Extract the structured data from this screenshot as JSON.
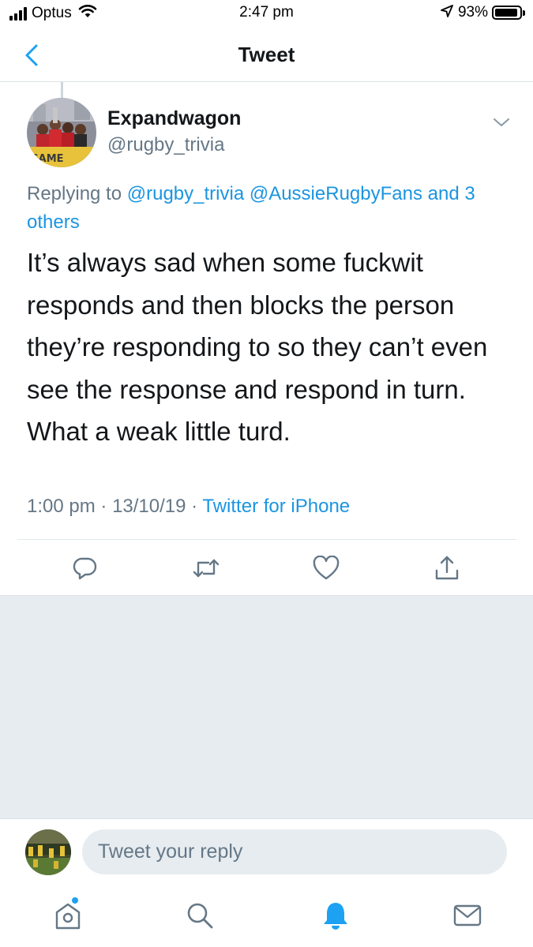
{
  "status_bar": {
    "carrier": "Optus",
    "time": "2:47 pm",
    "battery_percent": "93%",
    "battery_level": 0.93,
    "icons": [
      "signal-icon",
      "wifi-icon",
      "location-arrow-icon",
      "battery-icon"
    ]
  },
  "nav": {
    "title": "Tweet",
    "back_icon": "chevron-left-icon"
  },
  "tweet": {
    "author_name": "Expandwagon",
    "author_handle": "@rugby_trivia",
    "avatar_text": "GAME",
    "replying_prefix": "Replying to",
    "replying_to": "@rugby_trivia @AussieRugbyFans and 3 others",
    "text": "It’s always sad when some fuckwit responds and then blocks the person they’re responding to so they can’t even see the response and respond in turn. What a weak little turd.",
    "time": "1:00 pm",
    "date": "13/10/19",
    "separator": "·",
    "source": "Twitter for iPhone",
    "actions": [
      "reply-icon",
      "retweet-icon",
      "like-icon",
      "share-icon"
    ]
  },
  "reply_box": {
    "placeholder": "Tweet your reply"
  },
  "tab_bar": {
    "items": [
      "home-icon",
      "search-icon",
      "notifications-icon",
      "messages-icon"
    ],
    "active": "notifications-icon",
    "home_has_dot": true
  },
  "colors": {
    "accent": "#1da1f2",
    "link": "#1b95e0",
    "secondary_text": "#657786",
    "background_gray": "#e6ecf0"
  }
}
